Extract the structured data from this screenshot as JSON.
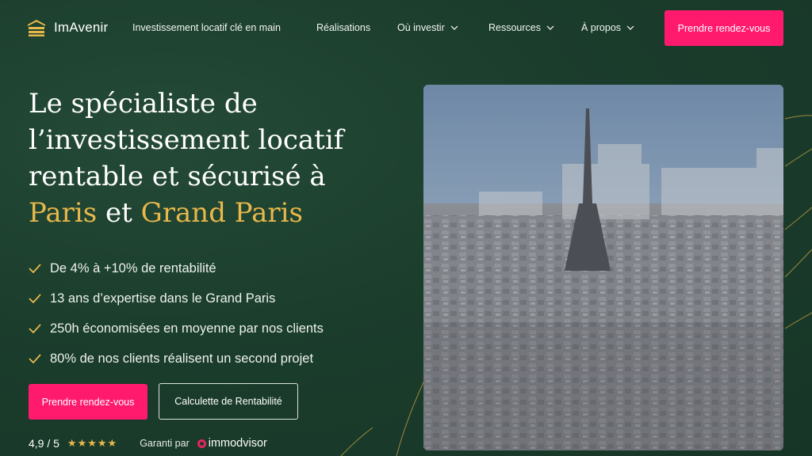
{
  "brand": {
    "name": "ImAvenir",
    "logo_icon": "stacked-roof-logo-icon",
    "accent_gold": "#e8b84a",
    "accent_pink": "#ff1a6e",
    "bg": "#1b3d2c"
  },
  "nav": {
    "items": [
      {
        "label": "Investissement locatif clé en main",
        "dropdown": false
      },
      {
        "label": "Réalisations",
        "dropdown": false
      },
      {
        "label": "Où investir",
        "dropdown": true
      },
      {
        "label": "Ressources",
        "dropdown": true
      },
      {
        "label": "À propos",
        "dropdown": true
      }
    ],
    "cta": "Prendre rendez-vous"
  },
  "hero": {
    "line1": "Le spécialiste de",
    "line2": "l’investissement locatif",
    "line3": "rentable et sécurisé à",
    "place1": "Paris",
    "connector": "et",
    "place2": "Grand Paris",
    "benefits": [
      "De 4% à +10% de rentabilité",
      "13 ans d’expertise dans le Grand Paris",
      "250h économisées en moyenne par nos clients",
      "80% de nos clients réalisent un second projet"
    ],
    "primary_button": "Prendre rendez-vous",
    "secondary_button": "Calculette de Rentabilité",
    "rating": "4,9 / 5",
    "stars": "★★★★★",
    "rating_value": 5,
    "guarantee": "Garanti par",
    "partner": "immodvisor"
  }
}
